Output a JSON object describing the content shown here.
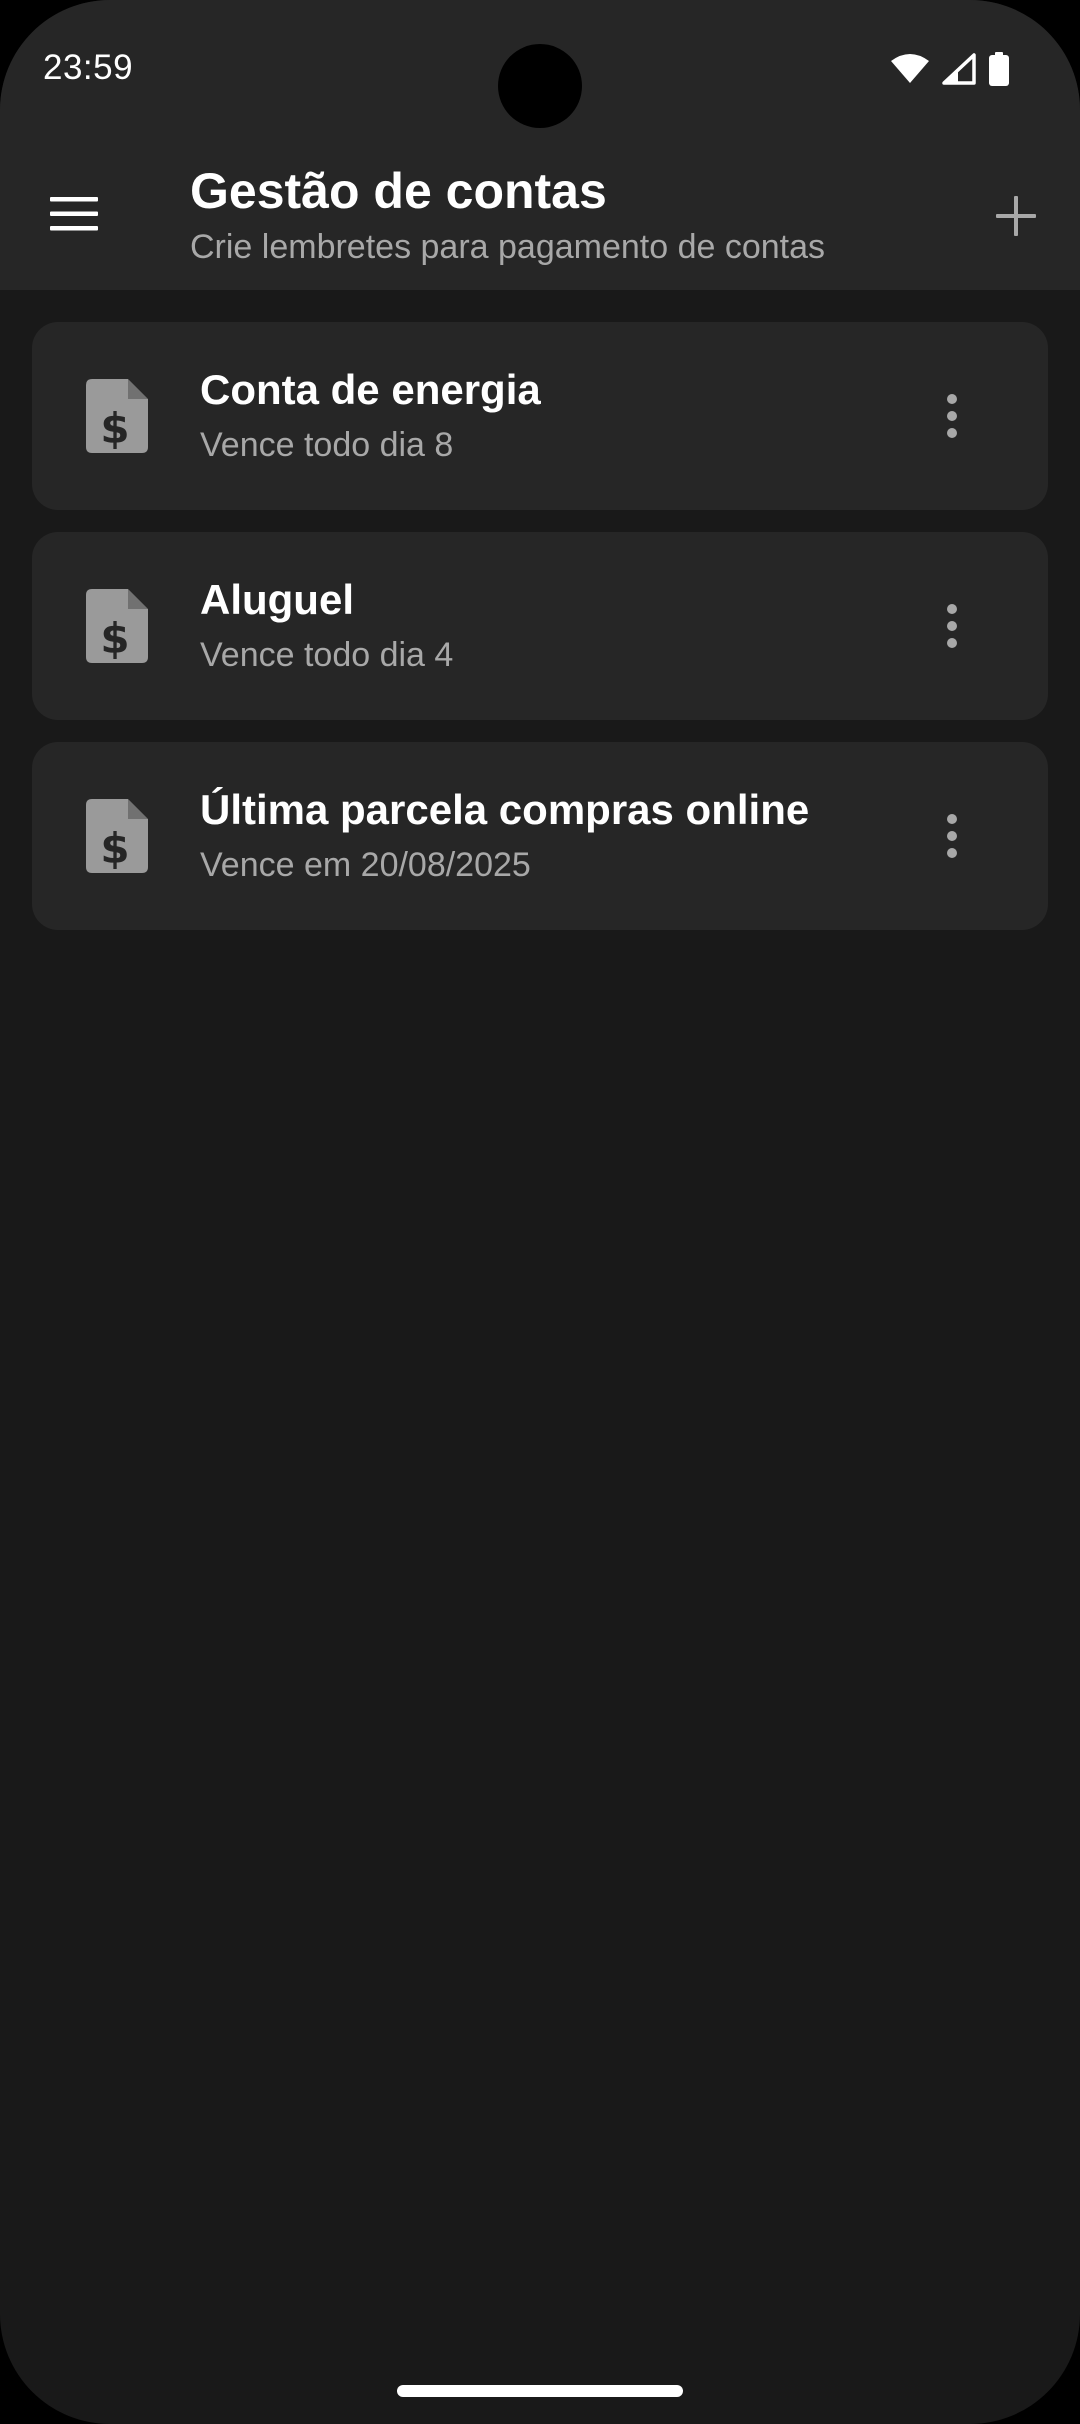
{
  "status_bar": {
    "time": "23:59",
    "icons": [
      "wifi-icon",
      "signal-icon",
      "battery-icon"
    ]
  },
  "app_bar": {
    "menu_icon": "hamburger-menu-icon",
    "title": "Gestão de contas",
    "subtitle": "Crie lembretes para pagamento de contas",
    "add_icon": "plus-icon"
  },
  "bills": [
    {
      "title": "Conta de energia",
      "due": "Vence todo dia 8",
      "icon": "invoice-dollar-icon",
      "menu_icon": "more-vertical-icon"
    },
    {
      "title": "Aluguel",
      "due": "Vence todo dia 4",
      "icon": "invoice-dollar-icon",
      "menu_icon": "more-vertical-icon"
    },
    {
      "title": "Última parcela compras online",
      "due": "Vence em 20/08/2025",
      "icon": "invoice-dollar-icon",
      "menu_icon": "more-vertical-icon"
    }
  ],
  "colors": {
    "background": "#191919",
    "surface": "#262626",
    "text_primary": "#ffffff",
    "text_secondary": "#a8a8a8",
    "icon": "#9a9a9a"
  }
}
